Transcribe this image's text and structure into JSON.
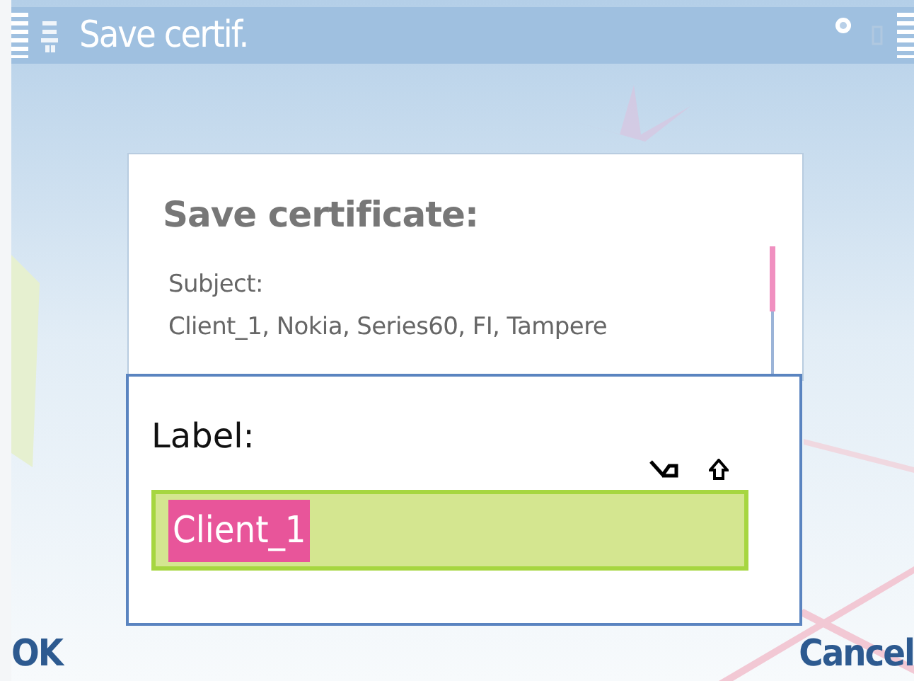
{
  "window": {
    "title": "Save certif."
  },
  "dialog": {
    "title": "Save certificate:",
    "lines": [
      "Subject:",
      "Client_1, Nokia, Series60, FI, Tampere"
    ]
  },
  "query": {
    "label": "Label:",
    "value": "Client_1",
    "value_selected": true
  },
  "softkeys": [
    "OK",
    "Cancel"
  ]
}
